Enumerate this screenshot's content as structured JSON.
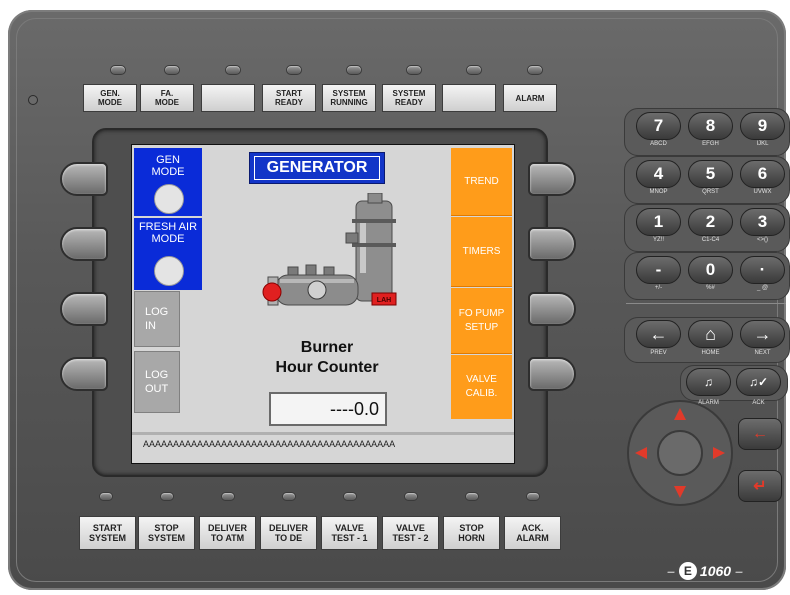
{
  "top_indicators": [
    {
      "label": "GEN.\nMODE"
    },
    {
      "label": "FA.\nMODE"
    },
    {
      "label": ""
    },
    {
      "label": "START\nREADY"
    },
    {
      "label": "SYSTEM\nRUNNING"
    },
    {
      "label": "SYSTEM\nREADY"
    },
    {
      "label": ""
    },
    {
      "label": "ALARM"
    }
  ],
  "screen": {
    "title": "GENERATOR",
    "gen_mode": "GEN\nMODE",
    "fresh_air_mode": "FRESH AIR\nMODE",
    "log_in": "LOG\nIN",
    "log_out": "LOG\nOUT",
    "trend": "TREND",
    "timers": "TIMERS",
    "fo_pump_setup": "FO PUMP\nSETUP",
    "valve_calib": "VALVE\nCALIB.",
    "lah_tag": "LAH",
    "counter_title_1": "Burner",
    "counter_title_2": "Hour Counter",
    "counter_value": "----0.0",
    "status_line": "AAAAAAAAAAAAAAAAAAAAAAAAAAAAAAAAAAAAAAAAAA"
  },
  "bottom_buttons": [
    {
      "label": "START\nSYSTEM"
    },
    {
      "label": "STOP\nSYSTEM"
    },
    {
      "label": "DELIVER\nTO ATM"
    },
    {
      "label": "DELIVER\nTO DE"
    },
    {
      "label": "VALVE\nTEST - 1"
    },
    {
      "label": "VALVE\nTEST - 2"
    },
    {
      "label": "STOP\nHORN"
    },
    {
      "label": "ACK.\nALARM"
    }
  ],
  "keypad": {
    "keys": [
      {
        "main": "7",
        "sub": "ABCD"
      },
      {
        "main": "8",
        "sub": "EFGH"
      },
      {
        "main": "9",
        "sub": "IJKL"
      },
      {
        "main": "4",
        "sub": "MNOP"
      },
      {
        "main": "5",
        "sub": "QRST"
      },
      {
        "main": "6",
        "sub": "UVWX"
      },
      {
        "main": "1",
        "sub": "YZ!!"
      },
      {
        "main": "2",
        "sub": "C1-C4"
      },
      {
        "main": "3",
        "sub": "<>()"
      },
      {
        "main": "-",
        "sub": "+/-"
      },
      {
        "main": "0",
        "sub": "%#"
      },
      {
        "main": "·",
        "sub": "_ @"
      }
    ],
    "nav": [
      {
        "glyph": "←",
        "label": "PREV"
      },
      {
        "glyph": "⌂",
        "label": "HOME"
      },
      {
        "glyph": "→",
        "label": "NEXT"
      }
    ],
    "alarm_label": "ALARM",
    "ack_label": "ACK",
    "brand": "1060"
  },
  "colors": {
    "screen_bg": "#d6d6d6",
    "mode_blue": "#0a2bd8",
    "menu_orange": "#ff9c1a",
    "alarm_red": "#e02020"
  }
}
